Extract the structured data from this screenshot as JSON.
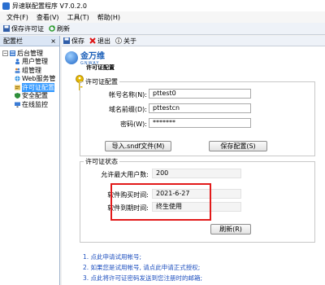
{
  "window": {
    "title": "异速联配置程序 V7.0.2.0"
  },
  "menu": [
    "文件(F)",
    "查看(V)",
    "工具(T)",
    "帮助(H)"
  ],
  "toolbar": {
    "save_license": "保存许可证",
    "refresh": "刷新",
    "save": "保存",
    "exit": "退出",
    "about": "关于"
  },
  "sidebar": {
    "title": "配置栏",
    "close": "×",
    "root": "后台管理",
    "items": [
      "用户管理",
      "组管理",
      "Web服务管",
      "许可证配置",
      "安全配置",
      "在线监控"
    ],
    "selected_index": 3
  },
  "brand": {
    "name": "金万维",
    "sub": "GNWAY"
  },
  "page_title": "许可证配置",
  "license_config": {
    "title": "许可证配置",
    "account_label": "帐号名称(N):",
    "account_value": "pttest0",
    "domain_label": "域名前缀(D):",
    "domain_value": "pttestcn",
    "password_label": "密码(W):",
    "password_value": "*******",
    "import_button": "导入.sndf文件(M)",
    "save_button": "保存配置(S)"
  },
  "license_status": {
    "title": "许可证状态",
    "max_users_label": "允许最大用户数:",
    "max_users_value": "200",
    "purchase_label": "软件购买时间:",
    "purchase_value": "2021-6-27",
    "expire_label": "软件到期时间:",
    "expire_value": "终生使用",
    "refresh_button": "刷新(R)"
  },
  "notes": [
    "1. 点此申请试用帐号;",
    "2. 如果您是试用帐号, 请点此申请正式授权;",
    "3. 点此将许可证密码发送到您注册时的邮箱;"
  ],
  "colors": {
    "highlight": "#e21a1a",
    "selection": "#3399ff",
    "link": "#1d4fbf"
  }
}
